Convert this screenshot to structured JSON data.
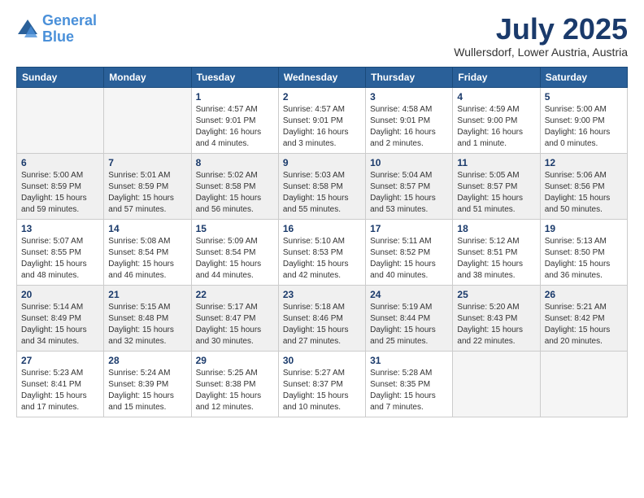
{
  "header": {
    "logo_line1": "General",
    "logo_line2": "Blue",
    "month": "July 2025",
    "location": "Wullersdorf, Lower Austria, Austria"
  },
  "days_of_week": [
    "Sunday",
    "Monday",
    "Tuesday",
    "Wednesday",
    "Thursday",
    "Friday",
    "Saturday"
  ],
  "weeks": [
    [
      {
        "day": "",
        "info": ""
      },
      {
        "day": "",
        "info": ""
      },
      {
        "day": "1",
        "info": "Sunrise: 4:57 AM\nSunset: 9:01 PM\nDaylight: 16 hours\nand 4 minutes."
      },
      {
        "day": "2",
        "info": "Sunrise: 4:57 AM\nSunset: 9:01 PM\nDaylight: 16 hours\nand 3 minutes."
      },
      {
        "day": "3",
        "info": "Sunrise: 4:58 AM\nSunset: 9:01 PM\nDaylight: 16 hours\nand 2 minutes."
      },
      {
        "day": "4",
        "info": "Sunrise: 4:59 AM\nSunset: 9:00 PM\nDaylight: 16 hours\nand 1 minute."
      },
      {
        "day": "5",
        "info": "Sunrise: 5:00 AM\nSunset: 9:00 PM\nDaylight: 16 hours\nand 0 minutes."
      }
    ],
    [
      {
        "day": "6",
        "info": "Sunrise: 5:00 AM\nSunset: 8:59 PM\nDaylight: 15 hours\nand 59 minutes."
      },
      {
        "day": "7",
        "info": "Sunrise: 5:01 AM\nSunset: 8:59 PM\nDaylight: 15 hours\nand 57 minutes."
      },
      {
        "day": "8",
        "info": "Sunrise: 5:02 AM\nSunset: 8:58 PM\nDaylight: 15 hours\nand 56 minutes."
      },
      {
        "day": "9",
        "info": "Sunrise: 5:03 AM\nSunset: 8:58 PM\nDaylight: 15 hours\nand 55 minutes."
      },
      {
        "day": "10",
        "info": "Sunrise: 5:04 AM\nSunset: 8:57 PM\nDaylight: 15 hours\nand 53 minutes."
      },
      {
        "day": "11",
        "info": "Sunrise: 5:05 AM\nSunset: 8:57 PM\nDaylight: 15 hours\nand 51 minutes."
      },
      {
        "day": "12",
        "info": "Sunrise: 5:06 AM\nSunset: 8:56 PM\nDaylight: 15 hours\nand 50 minutes."
      }
    ],
    [
      {
        "day": "13",
        "info": "Sunrise: 5:07 AM\nSunset: 8:55 PM\nDaylight: 15 hours\nand 48 minutes."
      },
      {
        "day": "14",
        "info": "Sunrise: 5:08 AM\nSunset: 8:54 PM\nDaylight: 15 hours\nand 46 minutes."
      },
      {
        "day": "15",
        "info": "Sunrise: 5:09 AM\nSunset: 8:54 PM\nDaylight: 15 hours\nand 44 minutes."
      },
      {
        "day": "16",
        "info": "Sunrise: 5:10 AM\nSunset: 8:53 PM\nDaylight: 15 hours\nand 42 minutes."
      },
      {
        "day": "17",
        "info": "Sunrise: 5:11 AM\nSunset: 8:52 PM\nDaylight: 15 hours\nand 40 minutes."
      },
      {
        "day": "18",
        "info": "Sunrise: 5:12 AM\nSunset: 8:51 PM\nDaylight: 15 hours\nand 38 minutes."
      },
      {
        "day": "19",
        "info": "Sunrise: 5:13 AM\nSunset: 8:50 PM\nDaylight: 15 hours\nand 36 minutes."
      }
    ],
    [
      {
        "day": "20",
        "info": "Sunrise: 5:14 AM\nSunset: 8:49 PM\nDaylight: 15 hours\nand 34 minutes."
      },
      {
        "day": "21",
        "info": "Sunrise: 5:15 AM\nSunset: 8:48 PM\nDaylight: 15 hours\nand 32 minutes."
      },
      {
        "day": "22",
        "info": "Sunrise: 5:17 AM\nSunset: 8:47 PM\nDaylight: 15 hours\nand 30 minutes."
      },
      {
        "day": "23",
        "info": "Sunrise: 5:18 AM\nSunset: 8:46 PM\nDaylight: 15 hours\nand 27 minutes."
      },
      {
        "day": "24",
        "info": "Sunrise: 5:19 AM\nSunset: 8:44 PM\nDaylight: 15 hours\nand 25 minutes."
      },
      {
        "day": "25",
        "info": "Sunrise: 5:20 AM\nSunset: 8:43 PM\nDaylight: 15 hours\nand 22 minutes."
      },
      {
        "day": "26",
        "info": "Sunrise: 5:21 AM\nSunset: 8:42 PM\nDaylight: 15 hours\nand 20 minutes."
      }
    ],
    [
      {
        "day": "27",
        "info": "Sunrise: 5:23 AM\nSunset: 8:41 PM\nDaylight: 15 hours\nand 17 minutes."
      },
      {
        "day": "28",
        "info": "Sunrise: 5:24 AM\nSunset: 8:39 PM\nDaylight: 15 hours\nand 15 minutes."
      },
      {
        "day": "29",
        "info": "Sunrise: 5:25 AM\nSunset: 8:38 PM\nDaylight: 15 hours\nand 12 minutes."
      },
      {
        "day": "30",
        "info": "Sunrise: 5:27 AM\nSunset: 8:37 PM\nDaylight: 15 hours\nand 10 minutes."
      },
      {
        "day": "31",
        "info": "Sunrise: 5:28 AM\nSunset: 8:35 PM\nDaylight: 15 hours\nand 7 minutes."
      },
      {
        "day": "",
        "info": ""
      },
      {
        "day": "",
        "info": ""
      }
    ]
  ]
}
